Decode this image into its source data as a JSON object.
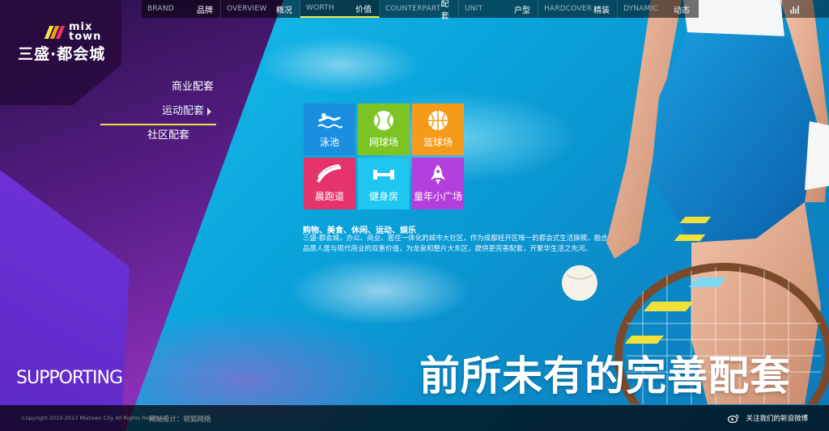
{
  "nav": {
    "items": [
      {
        "en": "BRAND",
        "cn": "品牌",
        "active": false
      },
      {
        "en": "OVERVIEW",
        "cn": "概况",
        "active": false
      },
      {
        "en": "WORTH",
        "cn": "价值",
        "active": true
      },
      {
        "en": "COUNTERPART",
        "cn": "配套",
        "active": false
      },
      {
        "en": "UNIT",
        "cn": "户型",
        "active": false
      },
      {
        "en": "HARDCOVER",
        "cn": "精装",
        "active": false
      },
      {
        "en": "DYNAMIC",
        "cn": "动态",
        "active": false
      }
    ]
  },
  "logo": {
    "mix": "mix",
    "town": "town",
    "cn": "三盛·都会城"
  },
  "side_menu": [
    {
      "label": "商业配套",
      "active": false
    },
    {
      "label": "运动配套",
      "active": true
    },
    {
      "label": "社区配套",
      "active": false
    }
  ],
  "tiles": [
    {
      "label": "泳池",
      "color": "#1a8fe0",
      "icon": "swimmer-icon"
    },
    {
      "label": "网球场",
      "color": "#7cc423",
      "icon": "tennis-ball-icon"
    },
    {
      "label": "篮球场",
      "color": "#f59a1b",
      "icon": "basketball-icon"
    },
    {
      "label": "晨跑道",
      "color": "#e5336b",
      "icon": "running-track-icon"
    },
    {
      "label": "健身房",
      "color": "#1ec6f0",
      "icon": "dumbbell-icon"
    },
    {
      "label": "童年小广场",
      "color": "#b43fdc",
      "icon": "rocket-icon"
    }
  ],
  "description": {
    "title": "购物、美食、休闲、运动、娱乐",
    "body": "三盛·都会城，办公、商业、居住一体化的城市大社区，作为成都经开区唯一的都会式生活旗舰，融合品质人居与现代商业的双重价值，为龙泉和整片大东区，提供更完善配套，开繁华生活之先河。"
  },
  "headline": "前所未有的完善配套",
  "supporting": "SUPPORTING",
  "footer": {
    "copyright": "Copyright 2010-2013 Mixtown City All Rights Reserved",
    "design": "网站设计：锐狐网络",
    "weibo": "关注我们的新浪微博"
  },
  "colors": {
    "accent_yellow": "#f5e84a",
    "purple": "#7a2aa8"
  }
}
